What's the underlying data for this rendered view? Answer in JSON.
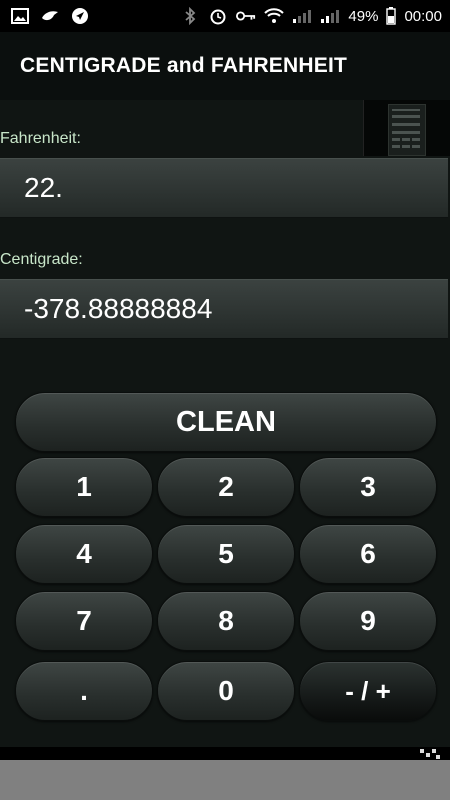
{
  "status_bar": {
    "icons_left": [
      "image-icon",
      "bird-icon",
      "navigation-icon"
    ],
    "icons_right": [
      "bluetooth-icon",
      "alarm-icon",
      "key-icon",
      "wifi-icon",
      "signal-icon",
      "signal-icon-2"
    ],
    "battery_percent": "49%",
    "time": "00:00"
  },
  "app": {
    "title": "CENTIGRADE and FAHRENHEIT"
  },
  "fahrenheit": {
    "label": "Fahrenheit:",
    "value": "22."
  },
  "centigrade": {
    "label": "Centigrade:",
    "value": "-378.88888884"
  },
  "keypad": {
    "clean": "CLEAN",
    "keys": [
      "1",
      "2",
      "3",
      "4",
      "5",
      "6",
      "7",
      "8",
      "9",
      ".",
      "0",
      "- / +"
    ]
  },
  "colors": {
    "background": "#101513",
    "label_text": "#c8e6c9",
    "title_bar": "#0b0f0e"
  }
}
